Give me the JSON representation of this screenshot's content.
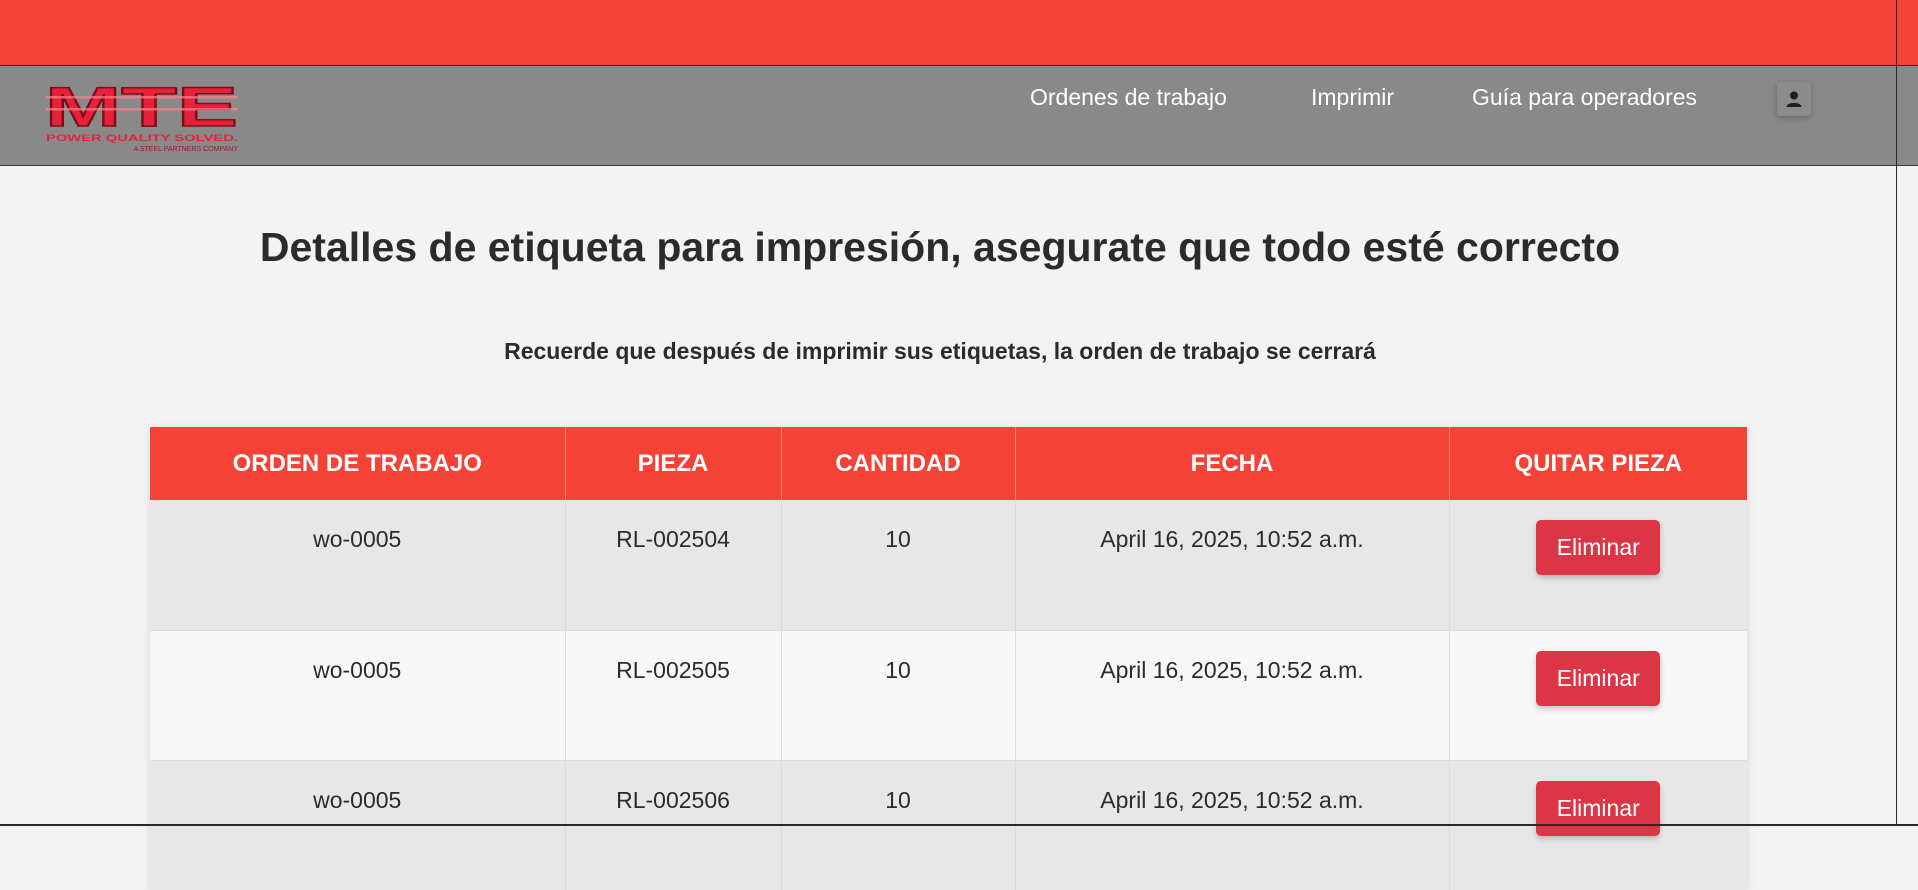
{
  "brand": {
    "logo_text": "MTE",
    "tagline": "POWER QUALITY SOLVED.",
    "company": "A STEEL PARTNERS COMPANY",
    "logo_color": "#e8213b"
  },
  "nav": {
    "items": [
      {
        "label": "Ordenes de trabajo"
      },
      {
        "label": "Imprimir"
      },
      {
        "label": "Guía para operadores"
      }
    ],
    "user_icon": "user-icon"
  },
  "page": {
    "title": "Detalles de etiqueta para impresión, asegurate que todo esté correcto",
    "subtitle": "Recuerde que después de imprimir sus etiquetas, la orden de trabajo se cerrará"
  },
  "table": {
    "headers": [
      "ORDEN DE TRABAJO",
      "PIEZA",
      "CANTIDAD",
      "FECHA",
      "QUITAR PIEZA"
    ],
    "rows": [
      {
        "orden": "wo-0005",
        "pieza": "RL-002504",
        "cantidad": "10",
        "fecha": "April 16, 2025, 10:52 a.m.",
        "accion": "Eliminar"
      },
      {
        "orden": "wo-0005",
        "pieza": "RL-002505",
        "cantidad": "10",
        "fecha": "April 16, 2025, 10:52 a.m.",
        "accion": "Eliminar"
      },
      {
        "orden": "wo-0005",
        "pieza": "RL-002506",
        "cantidad": "10",
        "fecha": "April 16, 2025, 10:52 a.m.",
        "accion": "Eliminar"
      }
    ]
  },
  "colors": {
    "accent": "#f44236",
    "navbar": "#898989",
    "danger": "#dc3545",
    "background": "#f3f3f3"
  }
}
